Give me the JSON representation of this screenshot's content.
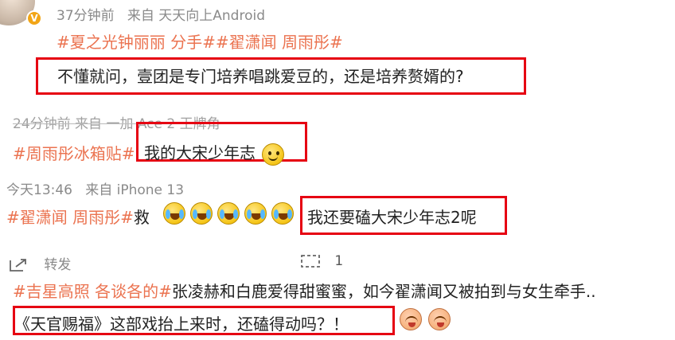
{
  "post1": {
    "time": "37分钟前",
    "source": "来自 天天向上Android",
    "tags": "#夏之光钟丽丽 分手##翟潇闻 周雨彤#",
    "text": "不懂就问，壹团是专门培养唱跳爱豆的，还是培养赘婿的?",
    "badge": "V"
  },
  "post2": {
    "meta": "24分钟前  来自 一加 Ace 2 王牌角",
    "tag": "#周雨彤冰箱贴#",
    "text": "我的大宋少年志",
    "emoji": "smile-emoji"
  },
  "post3": {
    "time": "今天13:46",
    "source": "来自 iPhone 13",
    "tags": "#翟潇闻 周雨彤#",
    "prefix": "救",
    "emoji": "crying-laughing-emoji",
    "text": "我还要磕大宋少年志2呢"
  },
  "actions": {
    "repost_label": "转发",
    "comment_count": "1"
  },
  "post4": {
    "tag": "#吉星高照 各谈各的#",
    "line1": "张凌赫和白鹿爱得甜蜜蜜，如今翟潇闻又被拍到与女生牵手..",
    "line2": "《天官赐福》这部戏抬上来时，还磕得动吗？！",
    "emoji": "drooling-emoji"
  },
  "colors": {
    "tag": "#eb7350",
    "meta": "#8a8a8a",
    "highlight_box": "#e60012",
    "text": "#222222"
  }
}
